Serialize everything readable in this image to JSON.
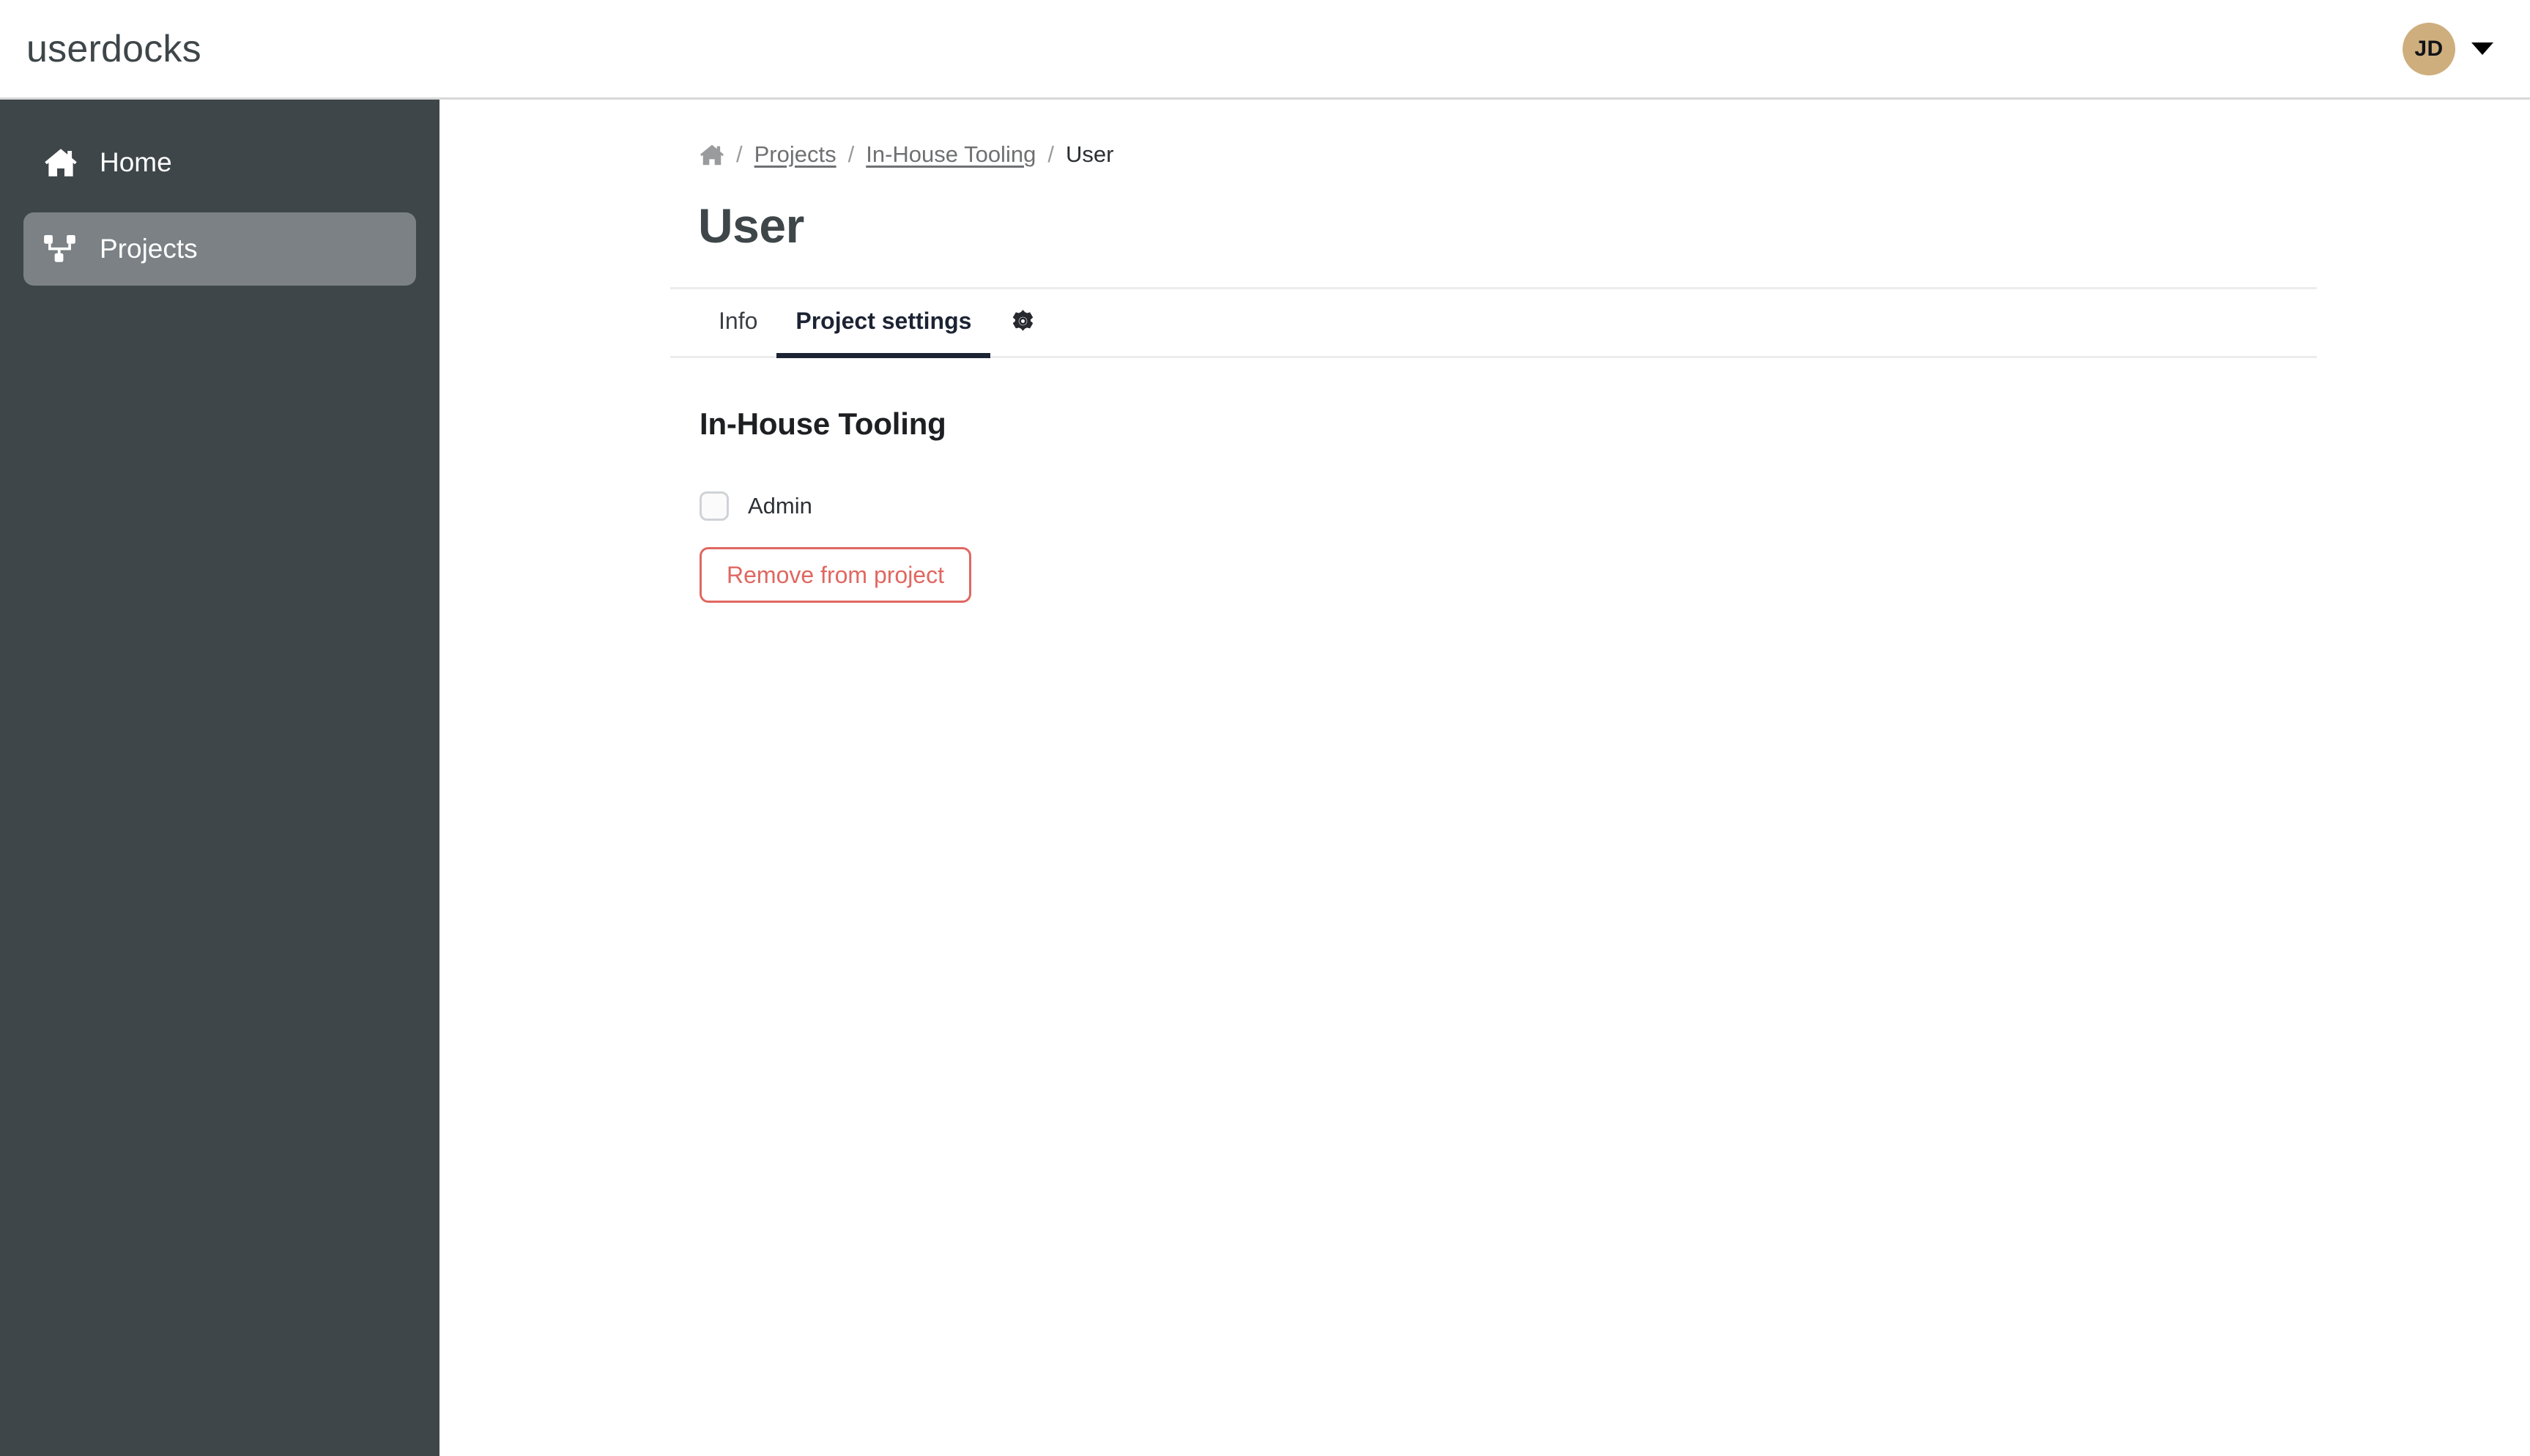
{
  "header": {
    "brand": "userdocks",
    "avatar_initials": "JD",
    "avatar_color": "#cfae7e",
    "caret_icon": "chevron-down-icon"
  },
  "sidebar": {
    "background": "#3e4649",
    "active_background": "#7b8184",
    "items": [
      {
        "label": "Home",
        "icon": "home-icon",
        "active": false
      },
      {
        "label": "Projects",
        "icon": "sitemap-icon",
        "active": true
      }
    ]
  },
  "main": {
    "breadcrumb": {
      "home_icon": "home-icon",
      "separator": "/",
      "items": [
        {
          "label": "Projects",
          "current": false
        },
        {
          "label": "In-House Tooling",
          "current": false
        },
        {
          "label": "User",
          "current": true
        }
      ]
    },
    "page_title": "User",
    "tabs": [
      {
        "label": "Info",
        "active": false
      },
      {
        "label": "Project settings",
        "active": true
      },
      {
        "label": "",
        "icon": "gear-icon",
        "active": false
      }
    ],
    "active_tab_color": "#1c2333",
    "content": {
      "section_title": "In-House Tooling",
      "checkbox": {
        "label": "Admin",
        "checked": false
      },
      "danger_button": {
        "label": "Remove from project",
        "color": "#e06761"
      }
    }
  }
}
